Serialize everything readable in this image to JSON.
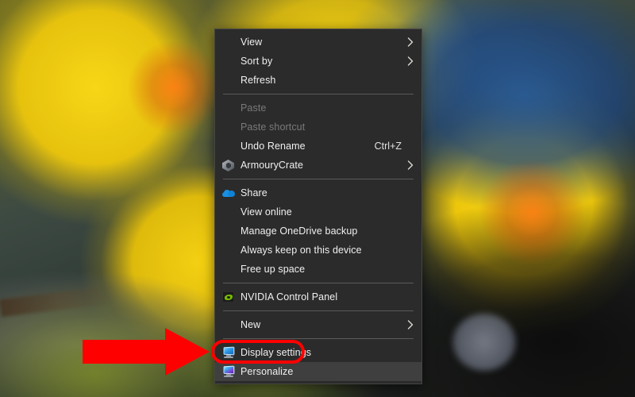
{
  "desktop": {
    "wallpaper_description": "close-up photo of yellow apricot blossoms with water droplets against a blue sky",
    "accent_colors": {
      "menu_background": "#2b2b2b",
      "menu_border": "#454545",
      "menu_text": "#f0f0f0",
      "menu_disabled_text": "#7a7a7a",
      "menu_hover_background": "#3f3f3f",
      "separator": "#5a5a5a",
      "annotation_red": "#ff0000"
    }
  },
  "context_menu": {
    "groups": [
      {
        "items": [
          {
            "label": "View",
            "icon": "none",
            "submenu": true,
            "disabled": false,
            "shortcut": ""
          },
          {
            "label": "Sort by",
            "icon": "none",
            "submenu": true,
            "disabled": false,
            "shortcut": ""
          },
          {
            "label": "Refresh",
            "icon": "none",
            "submenu": false,
            "disabled": false,
            "shortcut": ""
          }
        ]
      },
      {
        "items": [
          {
            "label": "Paste",
            "icon": "none",
            "submenu": false,
            "disabled": true,
            "shortcut": ""
          },
          {
            "label": "Paste shortcut",
            "icon": "none",
            "submenu": false,
            "disabled": true,
            "shortcut": ""
          },
          {
            "label": "Undo Rename",
            "icon": "none",
            "submenu": false,
            "disabled": false,
            "shortcut": "Ctrl+Z"
          },
          {
            "label": "ArmouryCrate",
            "icon": "armoury-crate-icon",
            "submenu": true,
            "disabled": false,
            "shortcut": ""
          }
        ]
      },
      {
        "items": [
          {
            "label": "Share",
            "icon": "onedrive-cloud-icon",
            "submenu": false,
            "disabled": false,
            "shortcut": ""
          },
          {
            "label": "View online",
            "icon": "none",
            "submenu": false,
            "disabled": false,
            "shortcut": ""
          },
          {
            "label": "Manage OneDrive backup",
            "icon": "none",
            "submenu": false,
            "disabled": false,
            "shortcut": ""
          },
          {
            "label": "Always keep on this device",
            "icon": "none",
            "submenu": false,
            "disabled": false,
            "shortcut": ""
          },
          {
            "label": "Free up space",
            "icon": "none",
            "submenu": false,
            "disabled": false,
            "shortcut": ""
          }
        ]
      },
      {
        "items": [
          {
            "label": "NVIDIA Control Panel",
            "icon": "nvidia-icon",
            "submenu": false,
            "disabled": false,
            "shortcut": ""
          }
        ]
      },
      {
        "items": [
          {
            "label": "New",
            "icon": "none",
            "submenu": true,
            "disabled": false,
            "shortcut": ""
          }
        ]
      },
      {
        "items": [
          {
            "label": "Display settings",
            "icon": "monitor-blue-icon",
            "submenu": false,
            "disabled": false,
            "shortcut": ""
          },
          {
            "label": "Personalize",
            "icon": "monitor-purple-icon",
            "submenu": false,
            "disabled": false,
            "shortcut": "",
            "hovered": true,
            "highlighted": true
          }
        ]
      }
    ]
  },
  "annotations": {
    "arrow": {
      "name": "red-pointer-arrow",
      "direction": "right",
      "color": "#ff0000"
    },
    "highlight_box": {
      "name": "personalize-highlight-box",
      "target": "Personalize",
      "color": "#ff0000"
    }
  }
}
